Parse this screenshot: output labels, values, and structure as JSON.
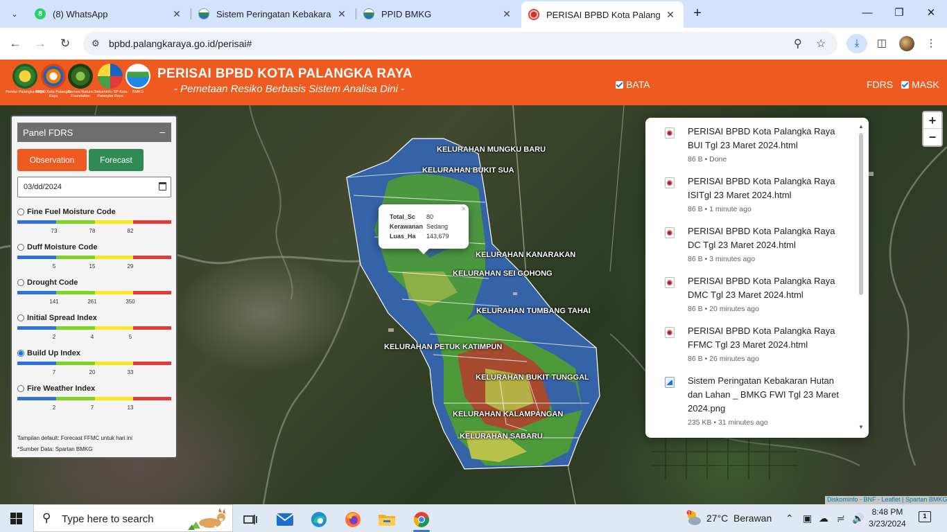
{
  "browser": {
    "tabs": [
      {
        "title": "(8) WhatsApp",
        "favicon": "whatsapp-icon",
        "color": "#25d366"
      },
      {
        "title": "Sistem Peringatan Kebakaran H",
        "favicon": "bmkg-globe-icon",
        "color": "#3a8e3a"
      },
      {
        "title": "PPID BMKG",
        "favicon": "bmkg-globe-icon",
        "color": "#3a8e3a"
      },
      {
        "title": "PERISAI BPBD Kota Palangka Ra",
        "favicon": "bpbd-logo-icon",
        "color": "#d93025"
      }
    ],
    "url": "bpbd.palangkaraya.go.id/perisai#"
  },
  "header": {
    "title": "PERISAI BPBD KOTA PALANGKA RAYA",
    "subtitle": "- Pemetaan Resiko Berbasis Sistem Analisa Dini -",
    "logos": [
      {
        "name": "pemko-palangka-raya-logo",
        "caption": "Pemko Palangka Raya",
        "color": "#2e7d32"
      },
      {
        "name": "bpbd-logo",
        "caption": "BPBD Kota Palangka Raya",
        "color": "#d84315"
      },
      {
        "name": "borneo-nature-logo",
        "caption": "Borneo Nature Foundation",
        "color": "#33691e"
      },
      {
        "name": "diskominfo-logo",
        "caption": "Diskominfo-SP Kota Palangka Raya",
        "color": "#1565c0"
      },
      {
        "name": "bmkg-logo",
        "caption": "BMKG",
        "color": "#1e88e5"
      }
    ],
    "layer_checks": [
      {
        "label": "BATA",
        "checked": true
      },
      {
        "label": "FDRS",
        "checked": true
      },
      {
        "label": "MASK",
        "checked": true
      }
    ]
  },
  "panel": {
    "title": "Panel FDRS",
    "collapse_symbol": "–",
    "observation_label": "Observation",
    "forecast_label": "Forecast",
    "date_value": "03/dd/2024",
    "indices": [
      {
        "name": "Fine Fuel Moisture Code",
        "ticks": [
          "73",
          "78",
          "82"
        ],
        "selected": false
      },
      {
        "name": "Duff Moisture Code",
        "ticks": [
          "5",
          "15",
          "29"
        ],
        "selected": false
      },
      {
        "name": "Drought Code",
        "ticks": [
          "141",
          "261",
          "350"
        ],
        "selected": false
      },
      {
        "name": "Initial Spread Index",
        "ticks": [
          "2",
          "4",
          "5"
        ],
        "selected": false
      },
      {
        "name": "Build Up Index",
        "ticks": [
          "7",
          "20",
          "33"
        ],
        "selected": true
      },
      {
        "name": "Fire Weather Index",
        "ticks": [
          "2",
          "7",
          "13"
        ],
        "selected": false
      }
    ],
    "scale_colors": [
      "#2f6fe0",
      "#7ed321",
      "#f8e71c",
      "#e53935"
    ],
    "note": "Tampilan default: Forecast FFMC untuk hari ini",
    "source": "*Sumber Data: Spartan BMKG"
  },
  "map": {
    "kelurahan_labels": [
      "KELURAHAN MUNGKU BARU",
      "KELURAHAN BUKIT SUA",
      "KELURAHAN KANARAKAN",
      "KELURAHAN SEI GOHONG",
      "KELURAHAN TUMBANG TAHAI",
      "KELURAHAN PETUK KATIMPUN",
      "KELURAHAN BUKIT TUNGGAL",
      "KELURAHAN KALAMPANGAN",
      "KELURAHAN SABARU"
    ],
    "popup": {
      "rows": [
        {
          "key": "Total_Sc",
          "value": "80"
        },
        {
          "key": "Kerawanan",
          "value": "Sedang"
        },
        {
          "key": "Luas_Ha",
          "value": "143,679"
        }
      ],
      "close": "×"
    },
    "zoom_in": "+",
    "zoom_out": "−",
    "attribution": "Diskominfo - BNF - Leaflet | Spartan BMKG",
    "zone_colors": {
      "blue": "#3563a8",
      "green": "#4d9a3a",
      "yellow": "#b7c24a",
      "red": "#b0432c"
    }
  },
  "downloads": [
    {
      "name": "PERISAI BPBD Kota Palangka Raya BUI Tgl 23 Maret 2024.html",
      "meta": "86 B • Done",
      "type": "html"
    },
    {
      "name": "PERISAI BPBD Kota Palangka Raya ISITgl 23 Maret 2024.html",
      "meta": "86 B • 1 minute ago",
      "type": "html"
    },
    {
      "name": "PERISAI BPBD Kota Palangka Raya DC Tgl 23 Maret 2024.html",
      "meta": "86 B • 3 minutes ago",
      "type": "html"
    },
    {
      "name": "PERISAI BPBD Kota Palangka Raya DMC Tgl 23 Maret 2024.html",
      "meta": "86 B • 20 minutes ago",
      "type": "html"
    },
    {
      "name": "PERISAI BPBD Kota Palangka Raya FFMC Tgl 23 Maret 2024.html",
      "meta": "86 B • 26 minutes ago",
      "type": "html"
    },
    {
      "name": "Sistem Peringatan Kebakaran Hutan dan Lahan _ BMKG FWI Tgl 23 Maret 2024.png",
      "meta": "235 KB • 31 minutes ago",
      "type": "png"
    }
  ],
  "taskbar": {
    "search_placeholder": "Type here to search",
    "weather_temp": "27°C",
    "weather_desc": "Berawan",
    "time": "8:48 PM",
    "date": "3/23/2024",
    "notification_count": "1"
  }
}
